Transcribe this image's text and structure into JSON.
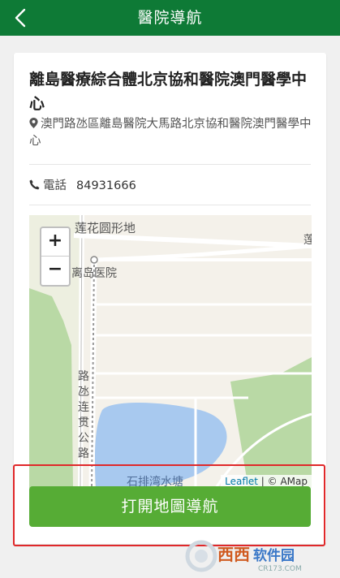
{
  "header": {
    "title": "醫院導航"
  },
  "hospital": {
    "name": "離島醫療綜合體北京協和醫院澳門醫學中心",
    "address": "澳門路氹區離島醫院大馬路北京協和醫院澳門醫學中心",
    "phone_label": "電話",
    "phone": "84931666"
  },
  "map": {
    "zoom_in": "+",
    "zoom_out": "−",
    "labels": {
      "lotus": "莲花圆形地",
      "hospital": "离岛医院",
      "road": "路氹连贯公路",
      "lake": "石排湾水塘",
      "edge": "莲"
    },
    "attribution": {
      "leaflet": "Leaflet",
      "separator": " | ",
      "amap": "© AMap"
    }
  },
  "button": {
    "label": "打開地圖導航"
  },
  "watermark": {
    "logo_text": "西西软件园",
    "url_text": "CR173.COM"
  },
  "colors": {
    "header": "#0e7a36",
    "button": "#56ac35",
    "highlight": "#e0282a"
  }
}
